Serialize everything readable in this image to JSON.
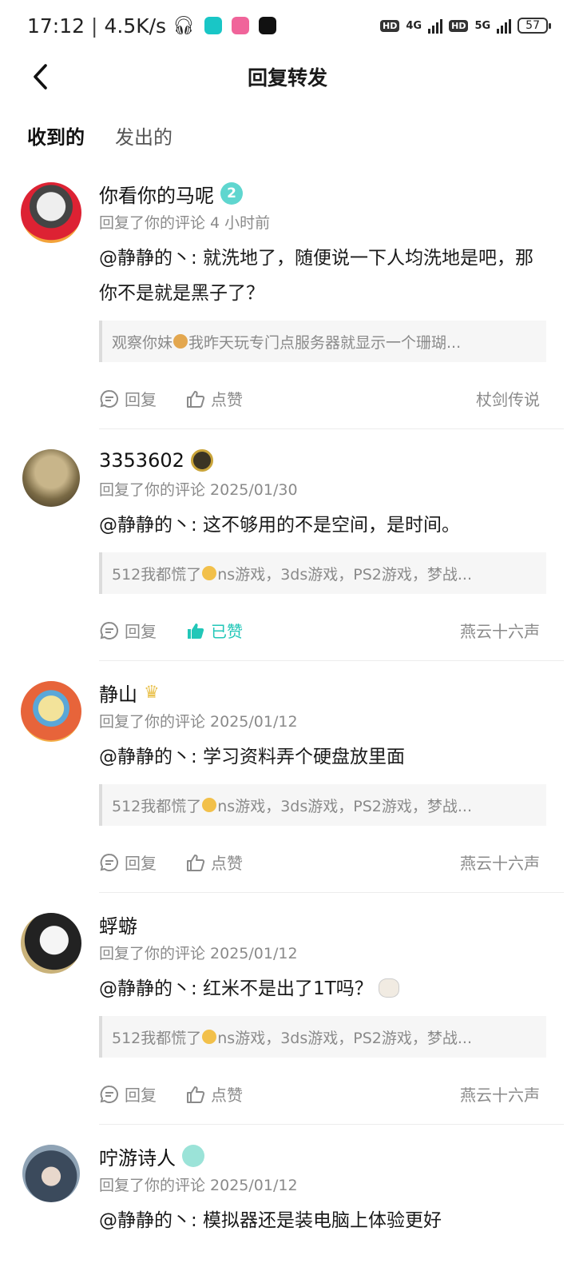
{
  "status_bar": {
    "time": "17:12",
    "speed": "4.5K/s",
    "net1": "4G",
    "net2": "5G",
    "hd": "HD",
    "battery": "57"
  },
  "header": {
    "title": "回复转发"
  },
  "tabs": [
    {
      "label": "收到的"
    },
    {
      "label": "发出的"
    }
  ],
  "actions": {
    "reply": "回复",
    "like": "点赞",
    "liked": "已赞"
  },
  "items": [
    {
      "username": "你看你的马呢",
      "badge": "2",
      "meta": "回复了你的评论 4 小时前",
      "reply": "@静静的丶: 就洗地了，随便说一下人均洗地是吧，那你不是就是黑子了？",
      "quote_pre": "观察你妹",
      "quote_post": "我昨天玩专门点服务器就显示一个珊瑚...",
      "source": "杖剑传说",
      "liked": false
    },
    {
      "username": "3353602",
      "meta": "回复了你的评论 2025/01/30",
      "reply": "@静静的丶: 这不够用的不是空间，是时间。",
      "quote_pre": "512我都慌了",
      "quote_post": "ns游戏，3ds游戏，PS2游戏，梦战...",
      "source": "燕云十六声",
      "liked": true
    },
    {
      "username": "静山",
      "meta": "回复了你的评论 2025/01/12",
      "reply": "@静静的丶: 学习资料弄个硬盘放里面",
      "quote_pre": "512我都慌了",
      "quote_post": "ns游戏，3ds游戏，PS2游戏，梦战...",
      "source": "燕云十六声",
      "liked": false
    },
    {
      "username": "蜉蝣",
      "meta": "回复了你的评论 2025/01/12",
      "reply": "@静静的丶: 红米不是出了1T吗？",
      "quote_pre": "512我都慌了",
      "quote_post": "ns游戏，3ds游戏，PS2游戏，梦战...",
      "source": "燕云十六声",
      "liked": false
    },
    {
      "username": "咛游诗人",
      "meta": "回复了你的评论 2025/01/12",
      "reply": "@静静的丶: 模拟器还是装电脑上体验更好"
    }
  ]
}
